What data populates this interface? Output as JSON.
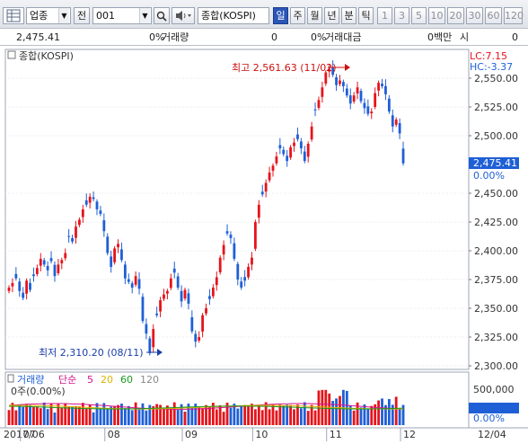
{
  "toolbar": {
    "market_select": "업종",
    "prev_label": "전",
    "code_value": "001",
    "index_name": "종합(KOSPI)",
    "periods": [
      "일",
      "주",
      "월",
      "년",
      "분",
      "틱"
    ],
    "active_period": "일",
    "intervals": [
      "1",
      "3",
      "5",
      "10",
      "20",
      "30",
      "60",
      "120"
    ]
  },
  "infobar": {
    "price": "2,475.41",
    "change_pct": "0%",
    "volume_label": "거래량",
    "volume_value": "0",
    "amount_pct": "0%",
    "amount_label": "거래대금",
    "amount_value": "0백만",
    "unit": "시",
    "unit_value": "0"
  },
  "chart": {
    "title": "종합(KOSPI)",
    "lc_label": "LC:7.15",
    "hc_label": "HC:-3.37",
    "high_annotation": "최고 2,561.63 (11/02)",
    "low_annotation": "최저 2,310.20 (08/11)",
    "current_price_tag": "2,475.41",
    "current_pct_tag": "0.00%",
    "y_ticks": [
      "2,550.00",
      "2,525.00",
      "2,500.00",
      "2,450.00",
      "2,425.00",
      "2,400.00",
      "2,375.00",
      "2,350.00",
      "2,325.00",
      "2,300.00"
    ],
    "y_tick_values": [
      2550,
      2525,
      2500,
      2450,
      2425,
      2400,
      2375,
      2350,
      2325,
      2300
    ],
    "x_labels": [
      "2017/06",
      "07",
      "08",
      "09",
      "10",
      "11",
      "12",
      "12/04"
    ],
    "x_label_index": [
      0,
      4,
      28,
      50,
      70,
      91,
      112,
      125
    ],
    "volume_legend": {
      "label": "거래량",
      "ma_label": "단순",
      "ma_periods": [
        "5",
        "20",
        "60",
        "120"
      ],
      "ma_colors": [
        "#d4148c",
        "#e0b400",
        "#1a9a1a",
        "#8a8a8a"
      ],
      "info": "0주(0.00%)"
    },
    "volume_ticks": [
      "500,000",
      "0",
      "0.00%"
    ],
    "up_color": "#e5141b",
    "down_color": "#1f5fd6"
  },
  "chart_data": {
    "type": "candlestick",
    "ylim": [
      2300,
      2565
    ],
    "high": {
      "value": 2561.63,
      "date": "11/02"
    },
    "low": {
      "value": 2310.2,
      "date": "08/11"
    },
    "last": 2475.41,
    "closes": [
      2368,
      2372,
      2376,
      2365,
      2359,
      2374,
      2366,
      2378,
      2385,
      2393,
      2388,
      2383,
      2391,
      2378,
      2388,
      2392,
      2398,
      2412,
      2408,
      2421,
      2427,
      2436,
      2440,
      2447,
      2445,
      2436,
      2432,
      2417,
      2398,
      2386,
      2402,
      2406,
      2392,
      2376,
      2373,
      2368,
      2378,
      2367,
      2339,
      2328,
      2311,
      2332,
      2344,
      2357,
      2362,
      2365,
      2376,
      2381,
      2368,
      2356,
      2366,
      2354,
      2330,
      2321,
      2325,
      2344,
      2350,
      2358,
      2368,
      2377,
      2394,
      2405,
      2415,
      2411,
      2393,
      2375,
      2368,
      2374,
      2386,
      2394,
      2425,
      2440,
      2449,
      2459,
      2468,
      2474,
      2482,
      2489,
      2484,
      2478,
      2490,
      2494,
      2497,
      2489,
      2478,
      2493,
      2508,
      2522,
      2531,
      2542,
      2555,
      2558,
      2553,
      2544,
      2548,
      2543,
      2535,
      2528,
      2535,
      2542,
      2530,
      2524,
      2519,
      2521,
      2537,
      2546,
      2543,
      2536,
      2521,
      2508,
      2514,
      2502,
      2476
    ],
    "volume_axis_max": 500000
  }
}
